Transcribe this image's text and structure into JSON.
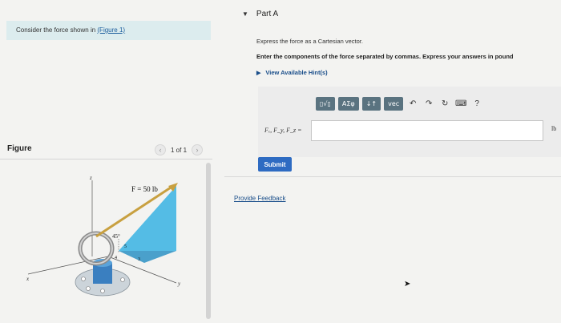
{
  "intro": {
    "text": "Consider the force shown in ",
    "link": "(Figure 1)"
  },
  "figure": {
    "label": "Figure",
    "pager": "1 of 1",
    "force_label": "F = 50 lb",
    "angle_label": "45°",
    "dims": [
      "4",
      "3",
      "5"
    ],
    "axes": [
      "z",
      "x",
      "y"
    ]
  },
  "part": {
    "title": "Part A",
    "instruction1": "Express the force as a Cartesian vector.",
    "instruction2": "Enter the components of the force separated by commas. Express your answers in pound",
    "hints": "View Available Hint(s)"
  },
  "toolbar": {
    "templates": "▯√▯",
    "greek": "ΑΣφ",
    "arrows": "↓↑",
    "vec": "vec",
    "undo": "↶",
    "redo": "↷",
    "reset": "↻",
    "keyboard": "⌨",
    "help": "?"
  },
  "answer": {
    "label": "Fₓ, F_y, F_z =",
    "value": "",
    "unit": "lb"
  },
  "submit_label": "Submit",
  "feedback_label": "Provide Feedback",
  "colors": {
    "accent": "#2e6bc2",
    "intro_bg": "#dcecee",
    "toolbar_btn": "#5a7380",
    "link": "#1a4e8a",
    "plane_fill": "#43b6e3",
    "force_arrow": "#c8a040"
  }
}
